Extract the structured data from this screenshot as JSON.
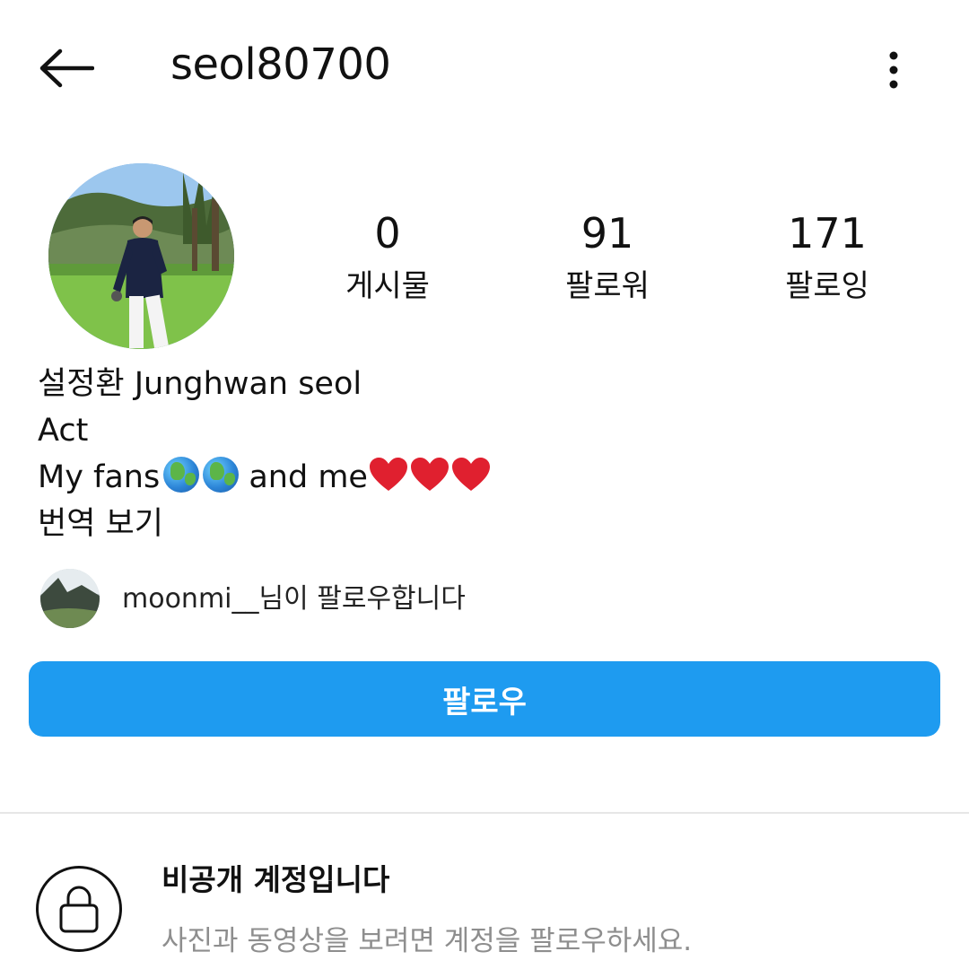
{
  "header": {
    "username": "seol80700",
    "back_icon": "arrow-left-icon",
    "more_icon": "more-vertical-icon"
  },
  "profile": {
    "stats": [
      {
        "value": "0",
        "label": "게시물"
      },
      {
        "value": "91",
        "label": "팔로워"
      },
      {
        "value": "171",
        "label": "팔로잉"
      }
    ],
    "bio": {
      "name": "설정환 Junghwan seol",
      "category": "Act",
      "line_start": "My fans",
      "line_middle": " and me",
      "emoji_globe_count": 2,
      "emoji_heart_count": 3,
      "translate": "번역 보기"
    },
    "followed_by": {
      "username": "moonmi__",
      "suffix": "님이 팔로우합니다"
    }
  },
  "actions": {
    "follow_label": "팔로우"
  },
  "private_account": {
    "title": "비공개 계정입니다",
    "subtitle": "사진과 동영상을 보려면 계정을 팔로우하세요.",
    "icon": "lock-icon"
  },
  "colors": {
    "accent": "#1e9bf0",
    "muted_text": "#8e8e8e",
    "divider": "#e6e6e6"
  }
}
